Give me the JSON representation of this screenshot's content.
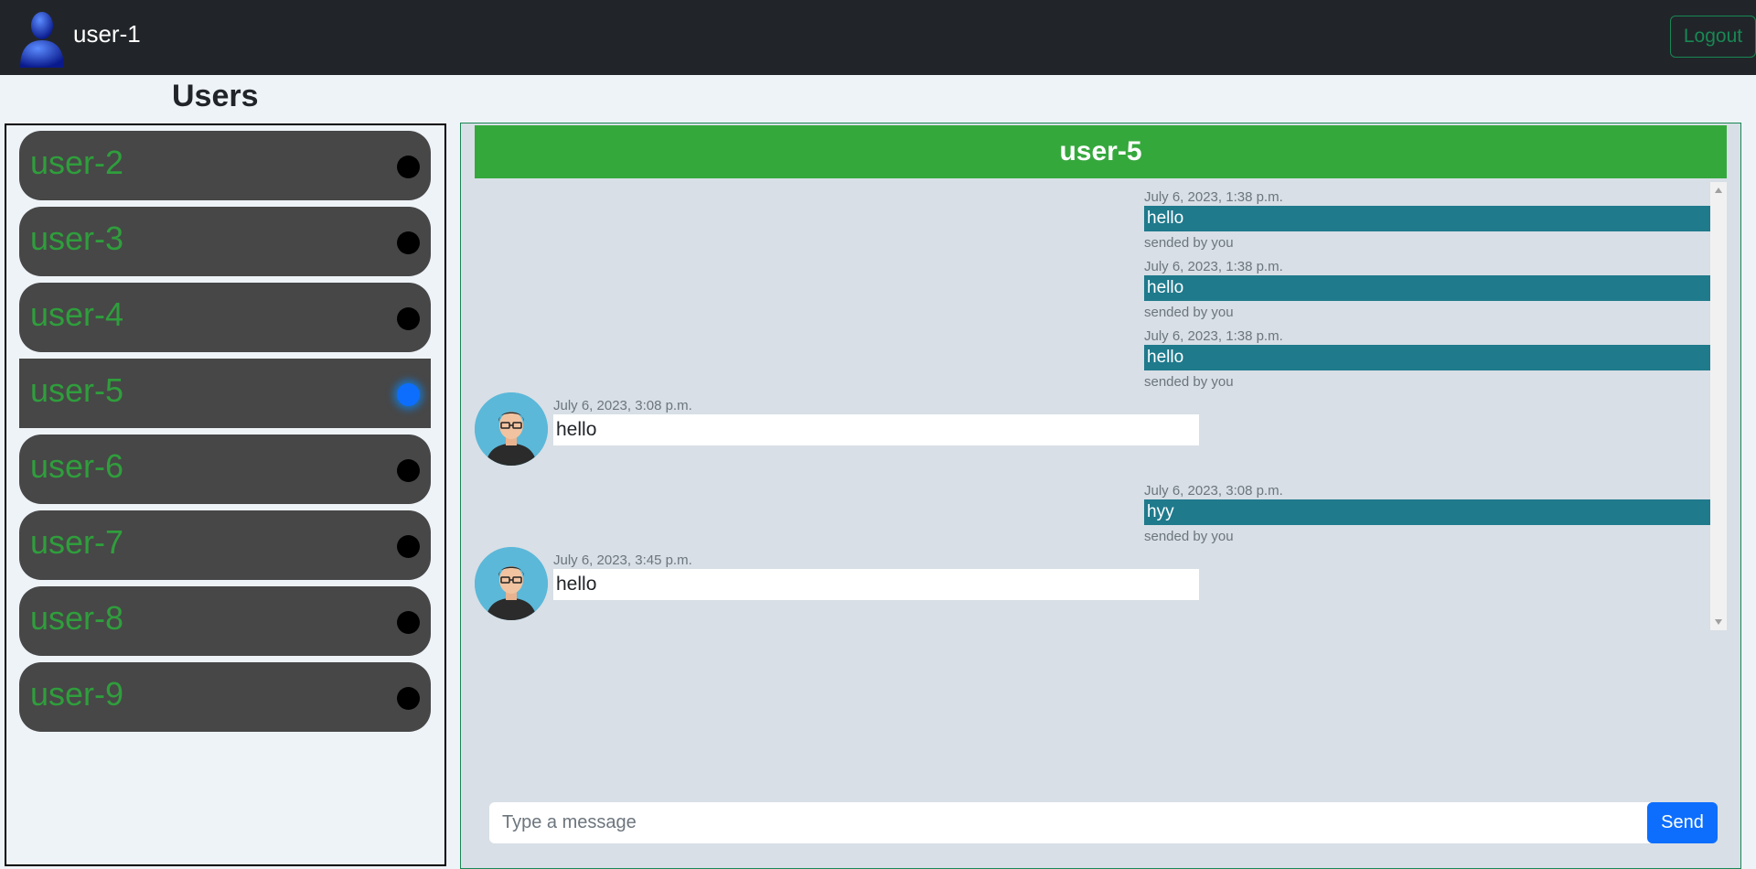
{
  "navbar": {
    "username": "user-1",
    "logout_label": "Logout",
    "avatar_icon": "user-avatar-icon"
  },
  "sidebar": {
    "title": "Users",
    "users": [
      {
        "name": "user-2",
        "online": false
      },
      {
        "name": "user-3",
        "online": false
      },
      {
        "name": "user-4",
        "online": false
      },
      {
        "name": "user-5",
        "online": true,
        "selected": true
      },
      {
        "name": "user-6",
        "online": false
      },
      {
        "name": "user-7",
        "online": false
      },
      {
        "name": "user-8",
        "online": false
      },
      {
        "name": "user-9",
        "online": false
      }
    ]
  },
  "chat": {
    "recipient": "user-5",
    "messages": [
      {
        "direction": "sent",
        "time": "July 6, 2023, 1:38 p.m.",
        "text": "hello",
        "by": "sended by you"
      },
      {
        "direction": "sent",
        "time": "July 6, 2023, 1:38 p.m.",
        "text": "hello",
        "by": "sended by you"
      },
      {
        "direction": "sent",
        "time": "July 6, 2023, 1:38 p.m.",
        "text": "hello",
        "by": "sended by you"
      },
      {
        "direction": "received",
        "time": "July 6, 2023, 3:08 p.m.",
        "text": "hello"
      },
      {
        "direction": "sent",
        "time": "July 6, 2023, 3:08 p.m.",
        "text": "hyy",
        "by": "sended by you"
      },
      {
        "direction": "received",
        "time": "July 6, 2023, 3:45 p.m.",
        "text": "hello"
      }
    ],
    "input_placeholder": "Type a message",
    "send_label": "Send"
  },
  "colors": {
    "navbar": "#212529",
    "accent_green": "#35a83c",
    "sent_bubble": "#1f7a8c",
    "send_button": "#0d6efd",
    "user_item": "#474747"
  }
}
